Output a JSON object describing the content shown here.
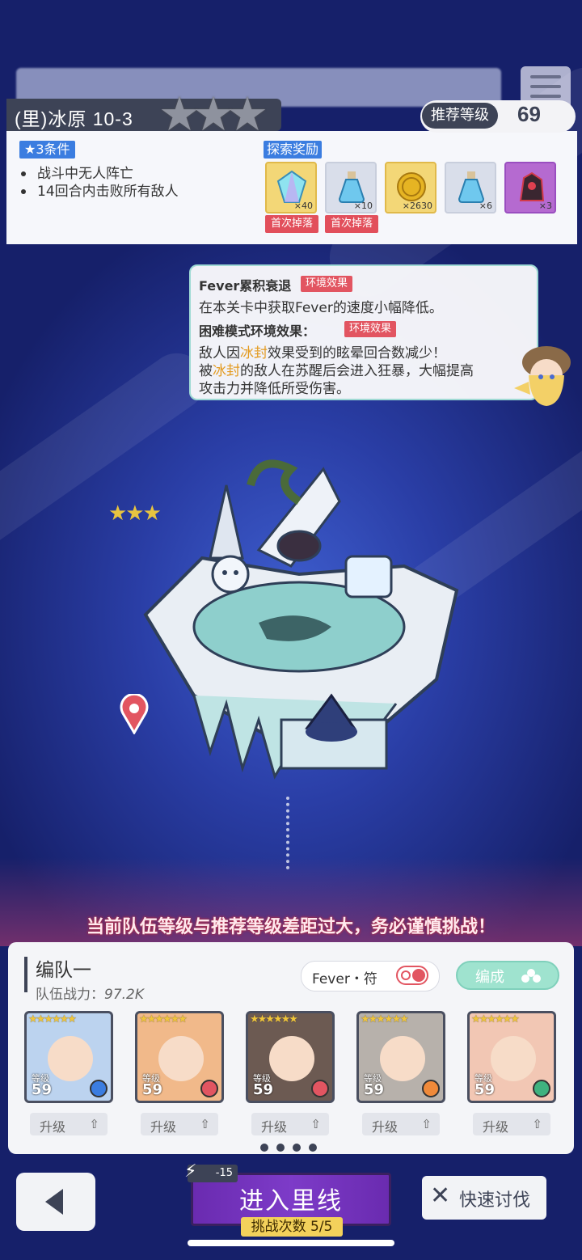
{
  "stage": {
    "title": "(里)冰原 10-3",
    "stars": 3,
    "recommended_label": "推荐等级",
    "recommended_level": "69"
  },
  "conditions": {
    "badge": "★3条件",
    "items": [
      "战斗中无人阵亡",
      "14回合内击败所有敌人"
    ]
  },
  "rewards": {
    "label": "探索奖励",
    "items": [
      {
        "icon": "crystal-gem-icon",
        "count": "×40",
        "first_drop": "首次掉落"
      },
      {
        "icon": "blue-potion-icon",
        "count": "×10",
        "first_drop": "首次掉落"
      },
      {
        "icon": "gold-coin-icon",
        "count": "×2630"
      },
      {
        "icon": "blue-potion-icon",
        "count": "×6"
      },
      {
        "icon": "dark-material-icon",
        "count": "×3"
      }
    ]
  },
  "environment": {
    "fever_title": "Fever累积衰退",
    "tag": "环境效果",
    "fever_desc": "在本关卡中获取Fever的速度小幅降低。",
    "hard_title": "困难模式环境效果：",
    "hard_tag": "环境效果",
    "line1_pre": "敌人因",
    "line1_hl": "冰封",
    "line1_post": "效果受到的眩晕回合数减少！",
    "line2_pre": "被",
    "line2_hl": "冰封",
    "line2_post": "的敌人在苏醒后会进入狂暴，大幅提高",
    "line3": "攻击力并降低所受伤害。"
  },
  "warning": "当前队伍等级与推荐等级差距过大，务必谨慎挑战！",
  "team": {
    "name": "编队一",
    "power_label": "队伍战力：",
    "power_value": "97.2K",
    "fever_label": "Fever・符",
    "form_label": "编成",
    "level_label": "等级",
    "upgrade_label": "升级",
    "members": [
      {
        "level": "59",
        "bg": "#bcd3ef",
        "elem": "#3b7de0"
      },
      {
        "level": "59",
        "bg": "#f1b98a",
        "elem": "#e25561"
      },
      {
        "level": "59",
        "bg": "#6c5a52",
        "elem": "#e25561"
      },
      {
        "level": "59",
        "bg": "#b7b1ab",
        "elem": "#f08a3a"
      },
      {
        "level": "59",
        "bg": "#f2c7b4",
        "elem": "#3fb27f"
      }
    ]
  },
  "controls": {
    "enter_label": "进入里线",
    "energy": "-15",
    "attempts_label": "挑战次数",
    "attempts_value": "5/5",
    "sweep_label": "快速讨伐"
  },
  "colors": {
    "accent_dark": "#3d4356",
    "tag_red": "#e25561",
    "badge_blue": "#3b7de0",
    "enter_purple": "#7d3bc8"
  }
}
